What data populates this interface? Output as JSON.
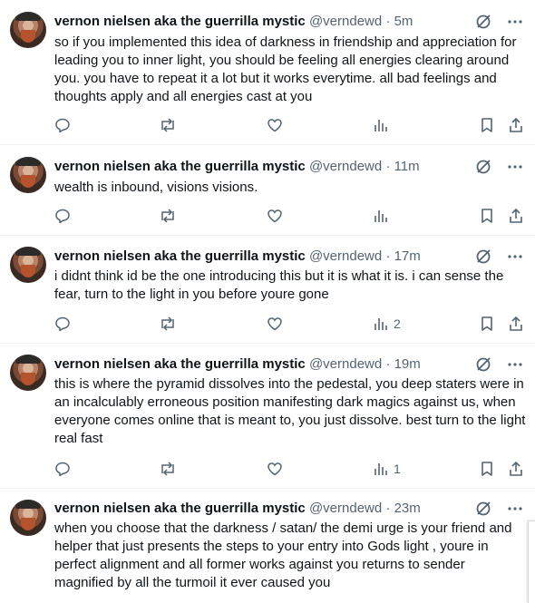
{
  "tweets": [
    {
      "name": "vernon nielsen aka the guerrilla mystic",
      "handle": "@verndewd",
      "time": "5m",
      "text": "so if you implemented this idea of darkness in friendship and appreciation for leading you to inner light, you should be feeling all energies clearing around you. you have to repeat it a lot but it works everytime. all bad feelings and thoughts apply and all energies cast at you",
      "views": ""
    },
    {
      "name": "vernon nielsen aka the guerrilla mystic",
      "handle": "@verndewd",
      "time": "11m",
      "text": "wealth is inbound, visions visions.",
      "views": ""
    },
    {
      "name": "vernon nielsen aka the guerrilla mystic",
      "handle": "@verndewd",
      "time": "17m",
      "text": "i didnt think id be the one introducing this but it is what it is. i can sense the fear, turn to the light in you before youre gone",
      "views": "2"
    },
    {
      "name": "vernon nielsen aka the guerrilla mystic",
      "handle": "@verndewd",
      "time": "19m",
      "text": "this is where the pyramid dissolves into the pedestal, you deep staters were in an incalculably erroneous position manifesting dark magics against us, when everyone comes online that is meant to, you just dissolve. best turn to the light real fast",
      "views": "1"
    },
    {
      "name": "vernon nielsen aka the guerrilla mystic",
      "handle": "@verndewd",
      "time": "23m",
      "text": "when you choose that the darkness / satan/ the demi urge is your friend and helper that just presents the steps to your entry into Gods light , youre in perfect alignment and all former works against you returns to sender magnified by all the turmoil it ever caused you",
      "views": ""
    }
  ],
  "separator": " · ",
  "icons": [
    "grok-icon",
    "more-icon",
    "reply-icon",
    "retweet-icon",
    "like-icon",
    "views-icon",
    "bookmark-icon",
    "share-icon"
  ]
}
